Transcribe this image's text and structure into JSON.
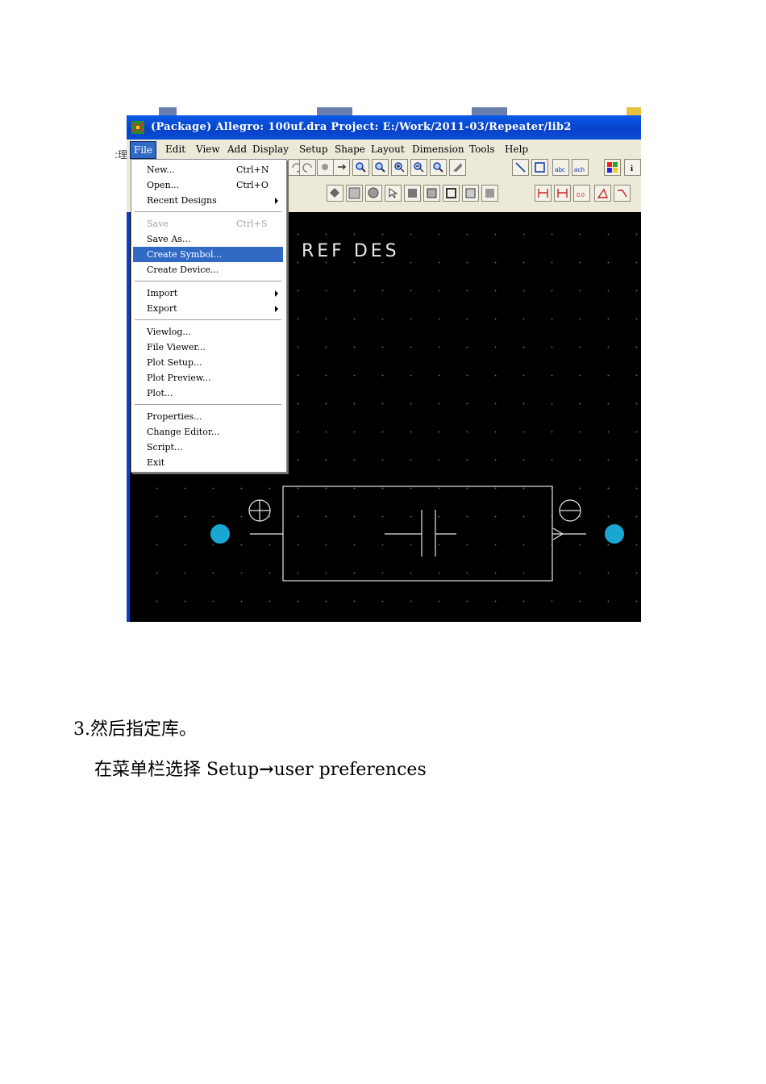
{
  "window": {
    "title": "(Package) Allegro: 100uf.dra  Project: E:/Work/2011-03/Repeater/lib2"
  },
  "menubar": [
    "File",
    "Edit",
    "View",
    "Add",
    "Display",
    "Setup",
    "Shape",
    "Layout",
    "Dimension",
    "Tools",
    "Help"
  ],
  "menubar_active": "File",
  "file_menu": {
    "groups": [
      [
        {
          "label": "New...",
          "accel": "Ctrl+N"
        },
        {
          "label": "Open...",
          "accel": "Ctrl+O"
        },
        {
          "label": "Recent Designs",
          "submenu": true
        }
      ],
      [
        {
          "label": "Save",
          "accel": "Ctrl+S",
          "disabled": true
        },
        {
          "label": "Save As..."
        },
        {
          "label": "Create Symbol...",
          "highlighted": true
        },
        {
          "label": "Create Device..."
        }
      ],
      [
        {
          "label": "Import",
          "submenu": true
        },
        {
          "label": "Export",
          "submenu": true
        }
      ],
      [
        {
          "label": "Viewlog..."
        },
        {
          "label": "File Viewer..."
        },
        {
          "label": "Plot Setup..."
        },
        {
          "label": "Plot Preview..."
        },
        {
          "label": "Plot..."
        }
      ],
      [
        {
          "label": "Properties..."
        },
        {
          "label": "Change Editor..."
        },
        {
          "label": "Script..."
        },
        {
          "label": "Exit"
        }
      ]
    ]
  },
  "canvas": {
    "ref_des": "REF DES",
    "pad_color": "#19a6d2",
    "background": "#000000"
  },
  "toolbar_icons": [
    "undo-icon",
    "redo-icon",
    "stop-icon",
    "zoom-points-icon",
    "zoom-fit-icon",
    "zoom-in-icon",
    "zoom-out-icon",
    "zoom-world-icon",
    "redraw-icon",
    "add-line-icon",
    "add-rect-icon",
    "add-text-icon",
    "change-text-icon",
    "color-icon",
    "info-icon"
  ],
  "doc": {
    "heading": "3.然后指定库。",
    "instruction_prefix": "在菜单栏选择 Setup",
    "instruction_arrow": "→",
    "instruction_suffix": "user preferences"
  },
  "side_fragments": [
    ":理"
  ]
}
